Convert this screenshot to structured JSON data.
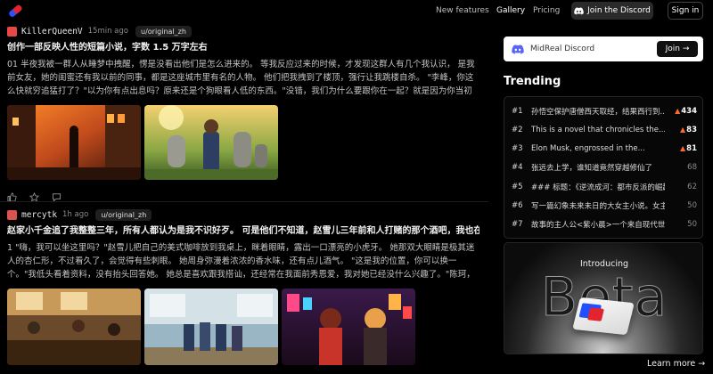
{
  "nav": {
    "links": [
      "New features",
      "Gallery",
      "Pricing"
    ],
    "active": "Gallery",
    "discord_label": "Join the Discord",
    "signin_label": "Sign in"
  },
  "posts": [
    {
      "username": "KillerQueenV",
      "time": "15min ago",
      "tag": "u/original_zh",
      "title": "创作一部反映人性的短篇小说，字数 1.5 万字左右",
      "body": "01 半夜我被一群人从睡梦中拽醒，愣是没看出他们是怎么进来的。 等我反应过来的时候，才发现这群人有几个我认识， 是我前女友，她的闺蜜还有我以前的同事，都是这座城市里有名的人物。 他们把我拽到了楼顶，强行让我跳楼自杀。 \"李峰，你这么快就穷追猛打了？\"以为你有点出息吗？原来还是个狗眼看人低的东西。\"没错，我们为什么要跟你在一起？就是因为你当初是..."
    },
    {
      "username": "mercytk",
      "time": "1h ago",
      "tag": "u/original_zh",
      "title": "赵家小千金追了我整整三年，所有人都认为是我不识好歹。 可是他们不知道，赵雪儿三年前和人打赌的那个酒吧，我也在场。 ...",
      "body": "1 \"嗨，我可以坐这里吗？\"赵雪儿把自己的美式咖啡放到我桌上，眯着眼睛，露出一口漂亮的小虎牙。 她那双大眼睛是极其迷人的杏仁形，不过看久了，会觉得有些刺眼。 她周身弥漫着浓浓的香水味，还有点儿酒气。 \"这是我的位置，你可以换一个。\"我低头看着资料，没有抬头回答她。 她总是喜欢跟我搭讪，还经常在我面前秀恩爱，我对她已经没什么兴趣了。\"陈珂，我知道..."
    }
  ],
  "sidebar": {
    "discord_name": "MidReal Discord",
    "join_label": "Join →",
    "trending_title": "Trending",
    "trending": [
      {
        "rank": "#1",
        "title": "孙悟空保护唐僧西天取经，结果西行到...",
        "score": "434",
        "hot": true
      },
      {
        "rank": "#2",
        "title": "This is a novel that chronicles the...",
        "score": "83",
        "hot": true
      },
      {
        "rank": "#3",
        "title": "Elon Musk, engrossed in the...",
        "score": "81",
        "hot": true
      },
      {
        "rank": "#4",
        "title": "张远去上学，谁知道竟然穿越修仙了",
        "score": "68",
        "hot": false
      },
      {
        "rank": "#5",
        "title": "### 标题：《逆流成河：都市反派的崛起...",
        "score": "62",
        "hot": false
      },
      {
        "rank": "#6",
        "title": "写一篇幻象未来未日的大女主小说。女主...",
        "score": "50",
        "hot": false
      },
      {
        "rank": "#7",
        "title": "故事的主人公<紫小晨>一个来自现代世界...",
        "score": "50",
        "hot": false
      }
    ],
    "beta_intro": "Introducing",
    "beta_word": "Beta",
    "learn_more": "Learn more →"
  },
  "colors": {
    "background": "#000000",
    "flame": "#ff6a2b",
    "avatar1": "#e8474a",
    "avatar2": "#d9534f"
  }
}
